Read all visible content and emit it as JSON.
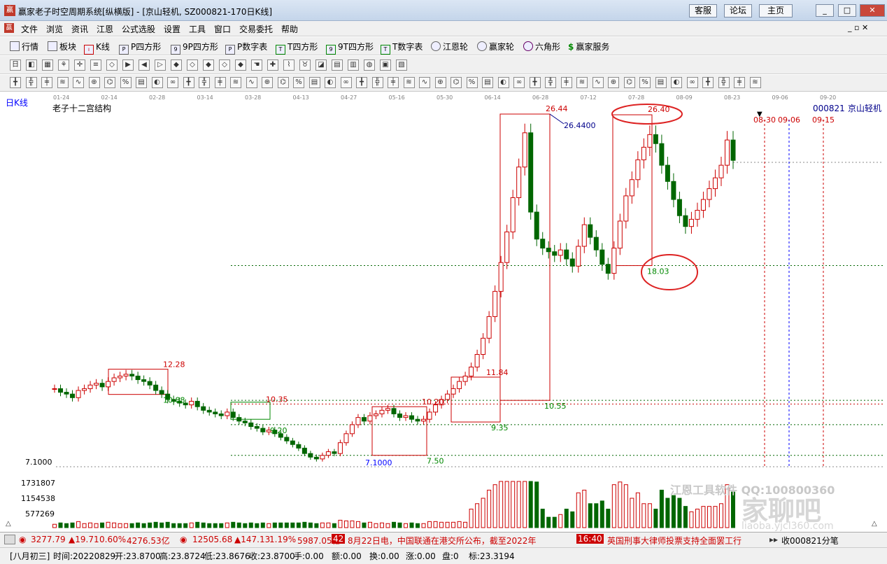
{
  "window": {
    "title": "赢家老子时空周期系统[纵横版] - [京山轻机, SZ000821-170日K线]",
    "buttons": [
      "客服",
      "论坛",
      "主页"
    ],
    "controls": [
      "_",
      "□",
      "✕"
    ]
  },
  "menu": [
    "文件",
    "浏览",
    "资讯",
    "江恩",
    "公式选股",
    "设置",
    "工具",
    "窗口",
    "交易委托",
    "帮助"
  ],
  "toolbar1": [
    "行情",
    "板块",
    "K线",
    "P四方形",
    "9P四方形",
    "P数字表",
    "T四方形",
    "9T四方形",
    "T数字表",
    "江恩轮",
    "赢家轮",
    "六角形",
    "赢家服务"
  ],
  "chart": {
    "period_label": "日K线",
    "indicator_label": "老子十二宫结构",
    "stock_code": "000821",
    "stock_name": "京山轻机",
    "top_dates": [
      "01-24",
      "02-14",
      "02-28",
      "03-14",
      "03-28",
      "04-13",
      "04-27",
      "05-16",
      "05-30",
      "06-14",
      "06-28",
      "07-12",
      "07-28",
      "08-09",
      "08-23",
      "09-06",
      "09-20"
    ],
    "future_dates": [
      "08-30",
      "09-06",
      "09-15"
    ],
    "price_axis_label": "7.1000",
    "vol_axis_labels": [
      "1731807",
      "1154538",
      "577269"
    ],
    "labels": {
      "p1228": "12.28",
      "p1088": "10.88",
      "p1035": "10.35",
      "p920": "9.20",
      "p710": "7.1000",
      "p750": "7.50",
      "p1020": "10.20",
      "p935": "9.35",
      "p1184": "11.84",
      "p1055": "10.55",
      "p2644": "26.44",
      "p264400": "26.4400",
      "p2640": "26.40",
      "p1803": "18.03"
    },
    "watermark1": "江恩工具软件  QQ:100800360",
    "watermark2": "家聊吧",
    "watermark3": "liaoba.yjcl360.com"
  },
  "chart_data": {
    "type": "candlestick",
    "title": "老子十二宫结构",
    "period": "日K线",
    "x": [
      "01-24",
      "02-14",
      "02-28",
      "03-14",
      "03-28",
      "04-13",
      "04-27",
      "05-16",
      "05-30",
      "06-14",
      "06-28",
      "07-12",
      "07-28",
      "08-09",
      "08-23"
    ],
    "key_prices": {
      "low": 7.1,
      "high": 26.44,
      "second_high": 26.4,
      "support": 18.03,
      "box_levels": [
        12.28,
        10.88,
        10.35,
        9.2,
        7.5,
        10.2,
        9.35,
        11.84,
        10.55
      ]
    },
    "ylim": [
      7.1,
      26.44
    ]
  },
  "status": {
    "index1_value": "3277.79",
    "index1_change": "▲19.71",
    "index1_pct": "0.60%",
    "index1_amt": "4276.53亿",
    "index2_value": "12505.68",
    "index2_change": "▲147.13",
    "index2_pct": "1.19%",
    "index2_amt": "5987.05亿",
    "news_num": "42",
    "news1": "8月22日电，中国联通在港交所公布，截至2022年",
    "news_time": "16:40",
    "news2": "英国刑事大律师投票支持全面罢工行",
    "quote": "收000821分笔"
  },
  "bottom": {
    "lunar": "[八月初三]",
    "time": "时间:20220829",
    "open": "开:23.8700",
    "high": "高:23.8724",
    "low": "低:23.8676",
    "close": "收:23.8700",
    "hand": "手:0.00",
    "amount": "额:0.00",
    "turnover": "换:0.00",
    "change": "涨:0.00",
    "pan": "盘:0",
    "mark": "标:23.3194"
  }
}
